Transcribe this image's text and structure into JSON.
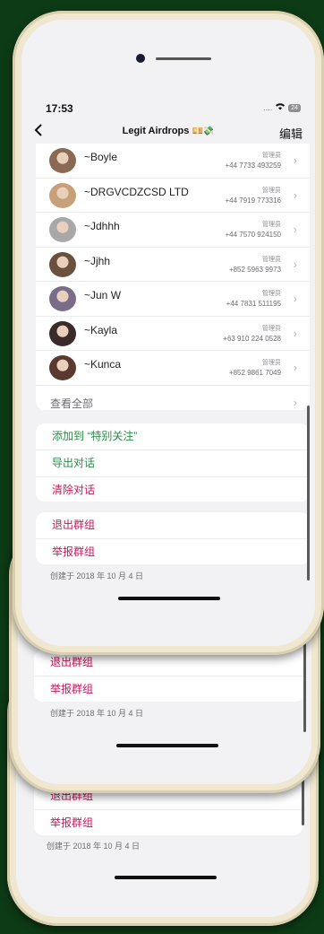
{
  "status": {
    "time": "17:53",
    "signal": "....",
    "battery": "24"
  },
  "nav": {
    "back": "<",
    "title": "Legit Airdrops",
    "title_emoji": "💴💸",
    "edit": "编辑"
  },
  "members": [
    {
      "name": "~Boyle",
      "role": "管理员",
      "phone": "+44 7733 493259"
    },
    {
      "name": "~DRGVCDZCSD LTD",
      "role": "管理员",
      "phone": "+44 7919 773316"
    },
    {
      "name": "~Jdhhh",
      "role": "管理员",
      "phone": "+44 7570 924150"
    },
    {
      "name": "~Jjhh",
      "role": "管理员",
      "phone": "+852 5963 9973"
    },
    {
      "name": "~Jun W",
      "role": "管理员",
      "phone": "+44 7831 511195"
    },
    {
      "name": "~Kayla",
      "role": "管理员",
      "phone": "+63 910 224 0528"
    },
    {
      "name": "~Kunca",
      "role": "管理员",
      "phone": "+852 9861 7049"
    }
  ],
  "view_all": "查看全部",
  "actions": {
    "add_special": "添加到 “特别关注”",
    "export_chat": "导出对话",
    "clear_chat": "清除对话",
    "leave_group": "退出群组",
    "report_group": "举报群组"
  },
  "created": "创建于 2018 年 10 月 4 日",
  "colors": {
    "background": "#0d3b16",
    "frame": "#efe7cf",
    "danger": "#c2185b",
    "accent": "#2e8a4a"
  }
}
